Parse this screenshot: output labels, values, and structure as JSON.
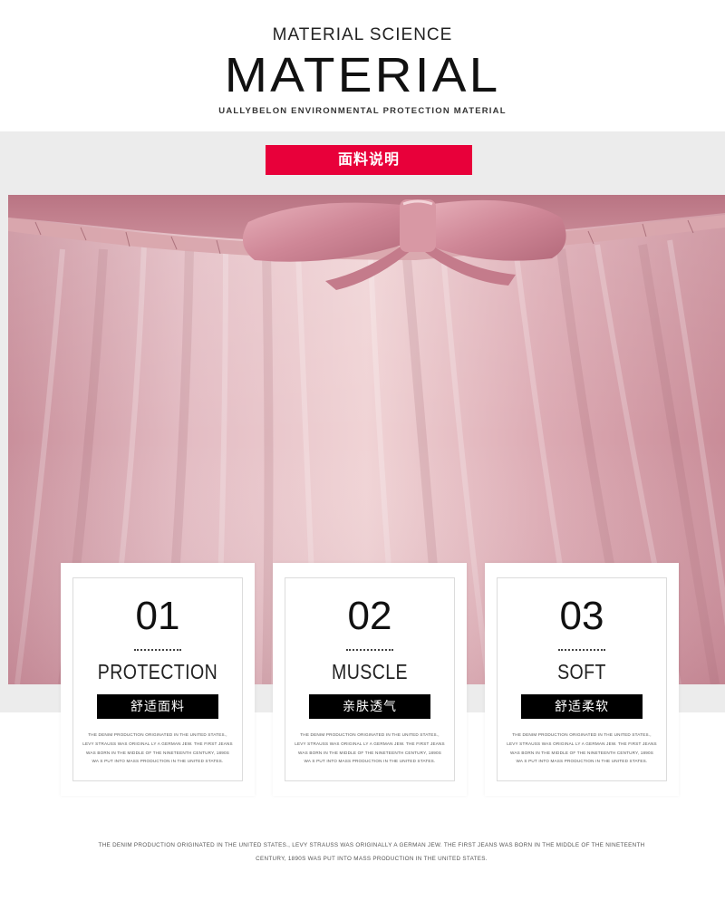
{
  "header": {
    "small_title": "MATERIAL SCIENCE",
    "big_title": "MATERIAL",
    "subtitle": "UALLYBELON ENVIRONMENTAL PROTECTION MATERIAL"
  },
  "section_label": "面料说明",
  "photo": {
    "subject": "pink tulle skirt with satin bow"
  },
  "cards": [
    {
      "number": "01",
      "title": "PROTECTION",
      "label": "舒适面料",
      "text": "THE DENIM PRODUCTION ORIGINATED IN THE UNITED STATES., LEVY STRAUSS WAS ORIGINAL LY A GERMAN JEW. THE FIRST JEANS WAS BORN IN THE MIDDLE OF THE NINETEENTH CENTURY, 1890S WA S PUT INTO MASS PRODUCTION IN THE UNITED STATES."
    },
    {
      "number": "02",
      "title": "MUSCLE",
      "label": "亲肤透气",
      "text": "THE DENIM PRODUCTION ORIGINATED IN THE UNITED STATES., LEVY STRAUSS WAS ORIGINAL LY A GERMAN JEW. THE FIRST JEANS WAS BORN IN THE MIDDLE OF THE NINETEENTH CENTURY, 1890S WA S PUT INTO MASS PRODUCTION IN THE UNITED STATES."
    },
    {
      "number": "03",
      "title": "SOFT",
      "label": "舒适柔软",
      "text": "THE DENIM PRODUCTION ORIGINATED IN THE UNITED STATES., LEVY STRAUSS WAS ORIGINAL LY A GERMAN JEW. THE FIRST JEANS WAS BORN IN THE MIDDLE OF THE NINETEENTH CENTURY, 1890S WA S PUT INTO MASS PRODUCTION IN THE UNITED STATES."
    }
  ],
  "footer": {
    "text": "THE DENIM PRODUCTION ORIGINATED IN THE UNITED STATES., LEVY STRAUSS WAS ORIGINALLY A GERMAN JEW. THE FIRST JEANS WAS BORN IN THE MIDDLE OF THE NINETEENTH CENTURY, 1890S WAS PUT INTO MASS PRODUCTION IN THE UNITED STATES."
  },
  "colors": {
    "accent_red": "#e8003a",
    "band_grey": "#ececec",
    "fabric_pink": "#d8a7b0"
  }
}
